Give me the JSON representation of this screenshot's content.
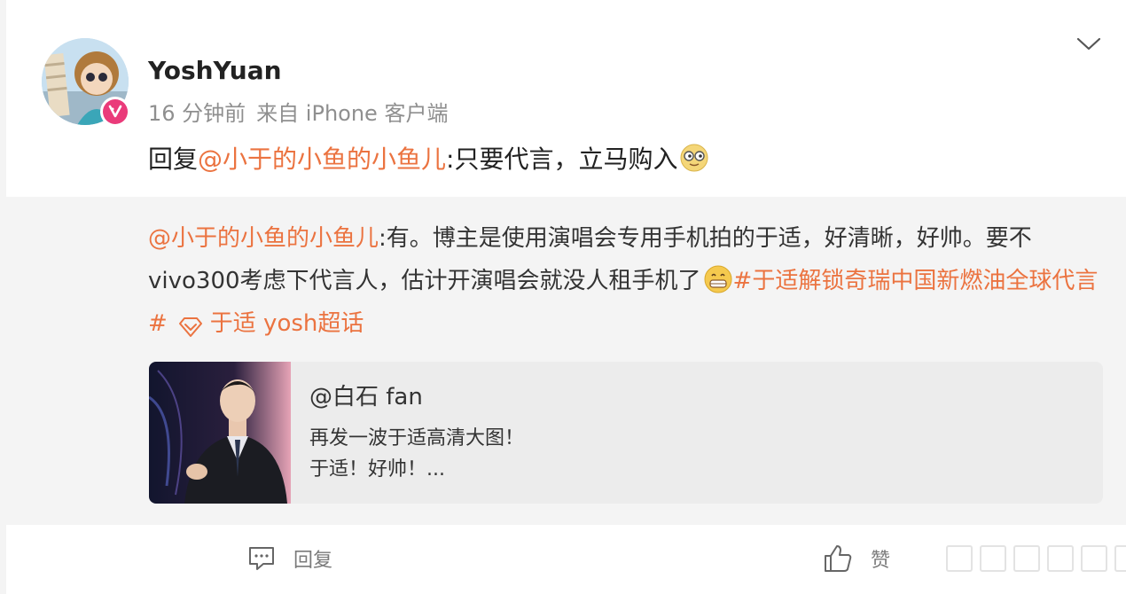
{
  "post": {
    "username": "YoshYuan",
    "time": "16 分钟前",
    "source": "来自 iPhone 客户端",
    "reply_prefix": "回复",
    "reply_mention": "@小于的小鱼的小鱼儿",
    "reply_text": ":只要代言，立马购入",
    "reply_emoji": "doge-emoji"
  },
  "quote": {
    "mention": "@小于的小鱼的小鱼儿",
    "text": ":有。博主是使用演唱会专用手机拍的于适，好清晰，好帅。要不vivo300考虑下代言人，估计开演唱会就没人租手机了",
    "emoji": "grin-emoji",
    "hashtag": "#于适解锁奇瑞中国新燃油全球代言#",
    "supertopic": "于适 yosh超话"
  },
  "link_card": {
    "title": "@白石 fan",
    "line1": "再发一波于适高清大图！",
    "line2": "于适！好帅！..."
  },
  "actions": {
    "reply_label": "回复",
    "like_label": "赞"
  },
  "colors": {
    "accent": "#eb7340",
    "badge": "#ea3b7a",
    "background": "#f4f4f4"
  }
}
